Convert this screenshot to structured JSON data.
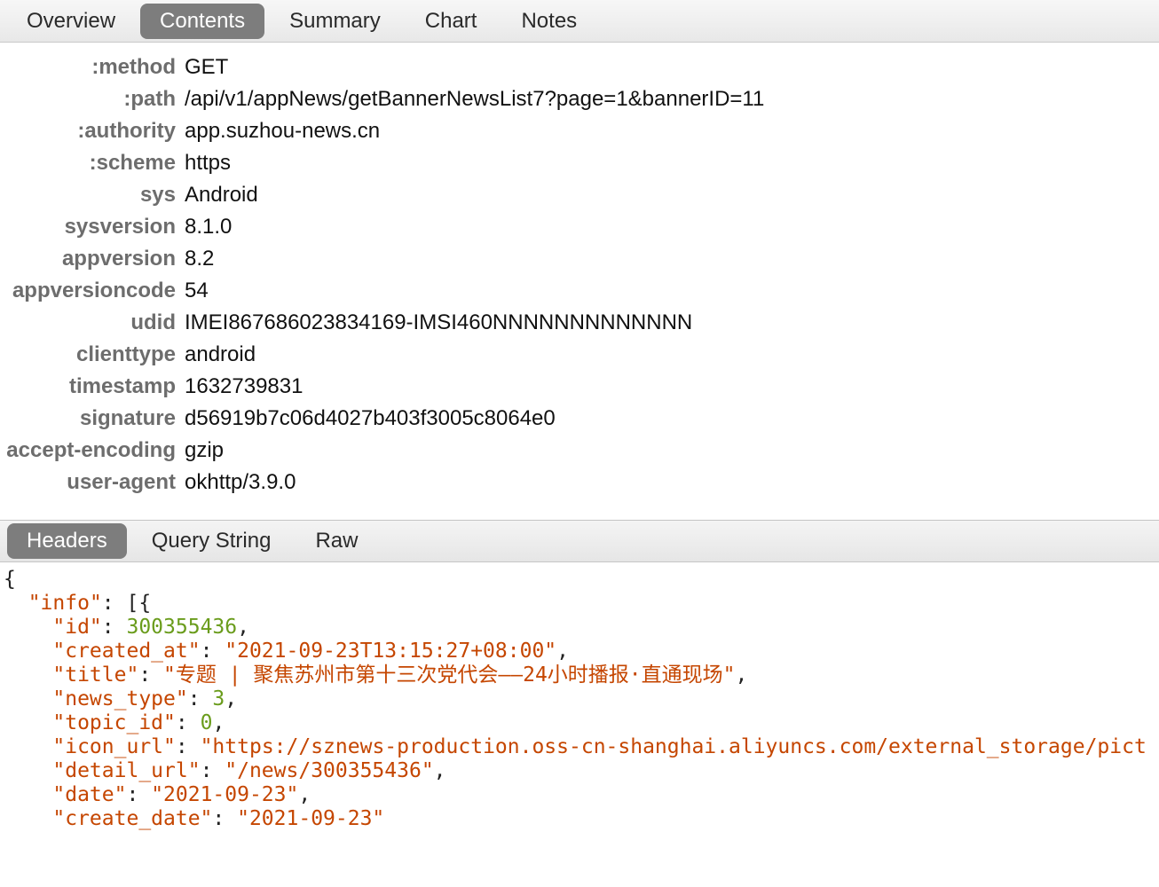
{
  "top_tabs": {
    "overview": "Overview",
    "contents": "Contents",
    "summary": "Summary",
    "chart": "Chart",
    "notes": "Notes"
  },
  "headers": [
    {
      "key": ":method",
      "val": "GET"
    },
    {
      "key": ":path",
      "val": "/api/v1/appNews/getBannerNewsList7?page=1&bannerID=11"
    },
    {
      "key": ":authority",
      "val": "app.suzhou-news.cn"
    },
    {
      "key": ":scheme",
      "val": "https"
    },
    {
      "key": "sys",
      "val": "Android"
    },
    {
      "key": "sysversion",
      "val": "8.1.0"
    },
    {
      "key": "appversion",
      "val": "8.2"
    },
    {
      "key": "appversioncode",
      "val": "54"
    },
    {
      "key": "udid",
      "val": "IMEI867686023834169-IMSI460NNNNNNNNNNNNN"
    },
    {
      "key": "clienttype",
      "val": "android"
    },
    {
      "key": "timestamp",
      "val": "1632739831"
    },
    {
      "key": "signature",
      "val": "d56919b7c06d4027b403f3005c8064e0"
    },
    {
      "key": "accept-encoding",
      "val": "gzip"
    },
    {
      "key": "user-agent",
      "val": "okhttp/3.9.0"
    }
  ],
  "sub_tabs": {
    "headers": "Headers",
    "query_string": "Query String",
    "raw": "Raw"
  },
  "response": {
    "brace_open": "{",
    "info_label": "\"info\"",
    "info_open": ": [{",
    "rows": [
      {
        "indent": 4,
        "k": "\"id\"",
        "sep": ": ",
        "v": "300355436",
        "vt": "num",
        "tail": ","
      },
      {
        "indent": 4,
        "k": "\"created_at\"",
        "sep": ": ",
        "v": "\"2021-09-23T13:15:27+08:00\"",
        "vt": "str",
        "tail": ","
      },
      {
        "indent": 4,
        "k": "\"title\"",
        "sep": ": ",
        "v": "\"专题 | 聚焦苏州市第十三次党代会——24小时播报·直通现场\"",
        "vt": "str",
        "tail": ","
      },
      {
        "indent": 4,
        "k": "\"news_type\"",
        "sep": ": ",
        "v": "3",
        "vt": "num",
        "tail": ","
      },
      {
        "indent": 4,
        "k": "\"topic_id\"",
        "sep": ": ",
        "v": "0",
        "vt": "num",
        "tail": ","
      },
      {
        "indent": 4,
        "k": "\"icon_url\"",
        "sep": ": ",
        "v": "\"https://sznews-production.oss-cn-shanghai.aliyuncs.com/external_storage/pict",
        "vt": "str",
        "tail": ""
      },
      {
        "indent": 4,
        "k": "\"detail_url\"",
        "sep": ": ",
        "v": "\"/news/300355436\"",
        "vt": "str",
        "tail": ","
      },
      {
        "indent": 4,
        "k": "\"date\"",
        "sep": ": ",
        "v": "\"2021-09-23\"",
        "vt": "str",
        "tail": ","
      },
      {
        "indent": 4,
        "k": "\"create_date\"",
        "sep": ": ",
        "v": "\"2021-09-23\"",
        "vt": "str",
        "tail": ""
      }
    ]
  }
}
